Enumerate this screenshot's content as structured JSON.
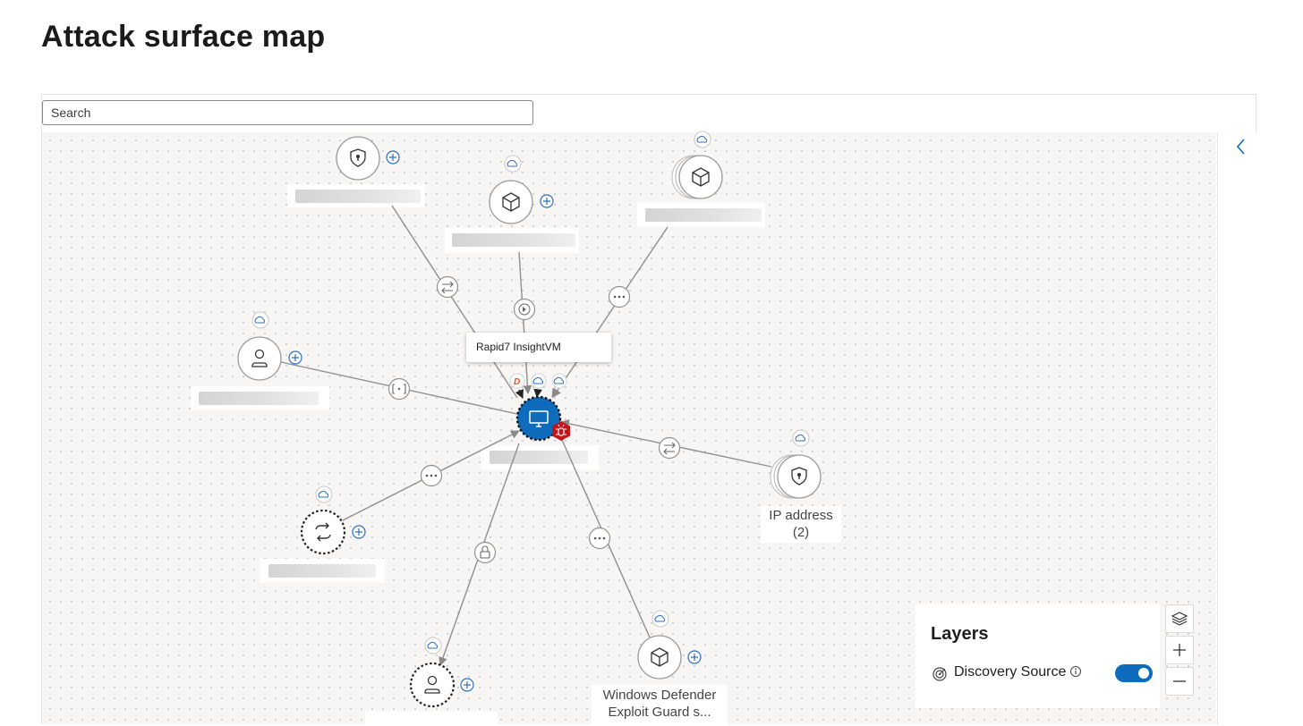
{
  "page": {
    "title": "Attack surface map"
  },
  "search": {
    "placeholder": "Search"
  },
  "tooltip": {
    "text": "Rapid7 InsightVM"
  },
  "nodes": {
    "ip_address": {
      "label_line1": "IP address",
      "label_line2": "(2)"
    },
    "windows_defender": {
      "label_line1": "Windows Defender",
      "label_line2": "Exploit Guard s..."
    }
  },
  "layers": {
    "title": "Layers",
    "discovery_source_label": "Discovery Source",
    "discovery_source_enabled": true
  },
  "icons": {
    "collapse": "chevron-left-icon",
    "layers": "layers-icon",
    "zoom_in": "plus-icon",
    "zoom_out": "minus-icon",
    "info": "info-icon",
    "discovery": "discovery-source-icon"
  },
  "colors": {
    "accent": "#0f6cbd",
    "device_node": "#0f6cbd",
    "vulnerability_badge": "#c4141b",
    "rapid7_logo": "#e8531f"
  }
}
